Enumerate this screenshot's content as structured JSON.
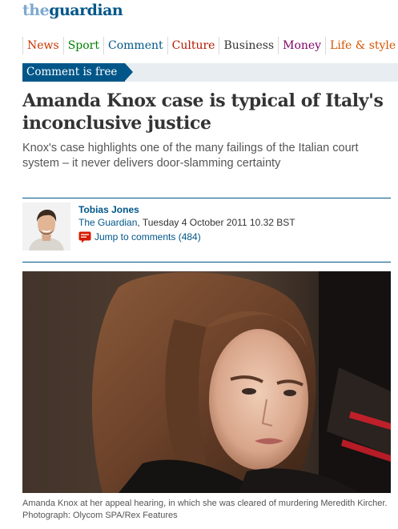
{
  "brand": {
    "the": "the",
    "guardian": "guardian"
  },
  "nav": {
    "items": [
      {
        "label": "News",
        "color": "#cc3300"
      },
      {
        "label": "Sport",
        "color": "#008000"
      },
      {
        "label": "Comment",
        "color": "#005689"
      },
      {
        "label": "Culture",
        "color": "#b51800"
      },
      {
        "label": "Business",
        "color": "#333333"
      },
      {
        "label": "Money",
        "color": "#7d0068"
      },
      {
        "label": "Life & style",
        "color": "#d45500"
      }
    ]
  },
  "section": {
    "label": "Comment is free",
    "color": "#005689"
  },
  "article": {
    "headline": "Amanda Knox case is typical of Italy's inconclusive justice",
    "standfirst": "Knox's case highlights one of the many failings of the Italian court system – it never delivers door-slamming certainty"
  },
  "byline": {
    "author": "Tobias Jones",
    "publication": "The Guardian",
    "date": ", Tuesday 4 October 2011 10.32 BST",
    "comments_link": "Jump to comments (484)",
    "comment_icon": "speech-bubble-icon"
  },
  "photo": {
    "caption": "Amanda Knox at her appeal hearing, in which she was cleared of murdering Meredith Kircher. Photograph: Olycom SPA/Rex Features"
  }
}
